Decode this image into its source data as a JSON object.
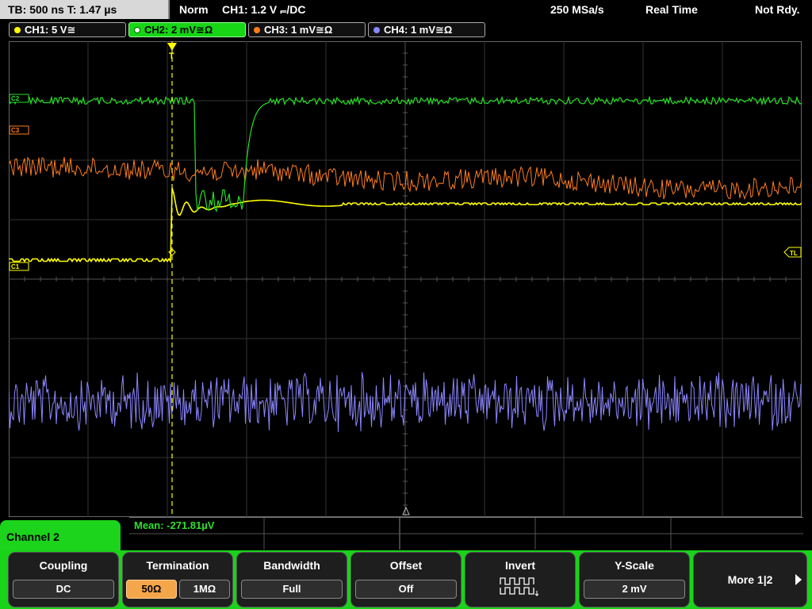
{
  "status_bar": {
    "timebase": "TB: 500 ns   T: 1.47 µs",
    "trigger_mode": "Norm",
    "trigger_info": "CH1: 1.2 V ⫭/DC",
    "sample_rate": "250 MSa/s",
    "acq_mode": "Real Time",
    "status": "Not Rdy."
  },
  "channels": [
    {
      "label": "CH1: 5 V≅",
      "color": "#ffff00",
      "active": false
    },
    {
      "label": "CH2: 2 mV≅Ω",
      "color": "#22dd22",
      "active": true
    },
    {
      "label": "CH3: 1 mV≅Ω",
      "color": "#ff7a1a",
      "active": false
    },
    {
      "label": "CH4: 1 mV≅Ω",
      "color": "#8888ff",
      "active": false
    }
  ],
  "markers": {
    "c2": "C2",
    "c3": "C3",
    "c1": "C1",
    "tl": "TL",
    "trigger": "T"
  },
  "measurement": {
    "mean": "Mean: -271.81µV"
  },
  "menu": {
    "channel_title": "Channel 2",
    "coupling": {
      "title": "Coupling",
      "value": "DC"
    },
    "termination": {
      "title": "Termination",
      "opt1": "50Ω",
      "opt2": "1MΩ",
      "selected": "50Ω"
    },
    "bandwidth": {
      "title": "Bandwidth",
      "value": "Full"
    },
    "offset": {
      "title": "Offset",
      "value": "Off"
    },
    "invert": {
      "title": "Invert"
    },
    "yscale": {
      "title": "Y-Scale",
      "value": "2 mV"
    },
    "more": {
      "label": "More 1|2"
    }
  }
}
